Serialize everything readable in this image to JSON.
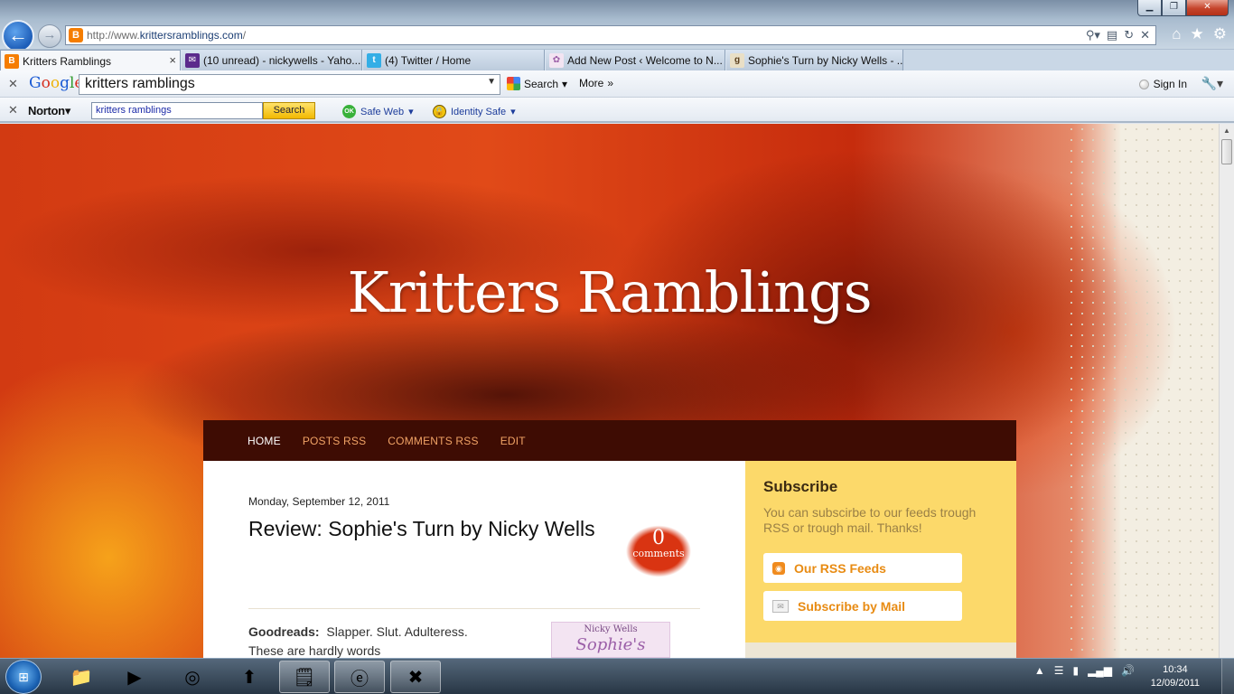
{
  "browser": {
    "url_prefix": "http://www.",
    "url_domain": "krittersramblings.com",
    "url_suffix": "/",
    "tabs": [
      {
        "label": "Kritters Ramblings",
        "close": "×"
      },
      {
        "label": "(10 unread) - nickywells - Yaho..."
      },
      {
        "label": "(4) Twitter / Home"
      },
      {
        "label": "Add New Post ‹ Welcome to N..."
      },
      {
        "label": "Sophie's Turn by Nicky Wells - ..."
      }
    ]
  },
  "google_toolbar": {
    "logo": [
      "G",
      "o",
      "o",
      "g",
      "l",
      "e"
    ],
    "query": "kritters ramblings",
    "search_label": "Search",
    "more_label": "More",
    "signin_label": "Sign In"
  },
  "norton_toolbar": {
    "logo": "Norton",
    "query": "kritters ramblings",
    "search_label": "Search",
    "safe_web_label": "Safe Web",
    "identity_safe_label": "Identity Safe"
  },
  "blog": {
    "title": "Kritters Ramblings",
    "nav": [
      "HOME",
      "POSTS RSS",
      "COMMENTS RSS",
      "EDIT"
    ],
    "post": {
      "date": "Monday, September 12, 2011",
      "title": "Review: Sophie's Turn by Nicky Wells",
      "comment_count": "0",
      "comment_label": "comments",
      "body_lead": "Goodreads:",
      "body_text": "Slapper.  Slut. Adulteress.  These are hardly words",
      "book_author": "Nicky Wells",
      "book_title": "Sophie's"
    },
    "sidebar": {
      "title": "Subscribe",
      "text": "You can subscirbe to our feeds trough RSS or trough mail. Thanks!",
      "rss_button": "Our RSS Feeds",
      "mail_button": "Subscribe by Mail"
    }
  },
  "taskbar": {
    "time": "10:34",
    "date": "12/09/2011"
  }
}
